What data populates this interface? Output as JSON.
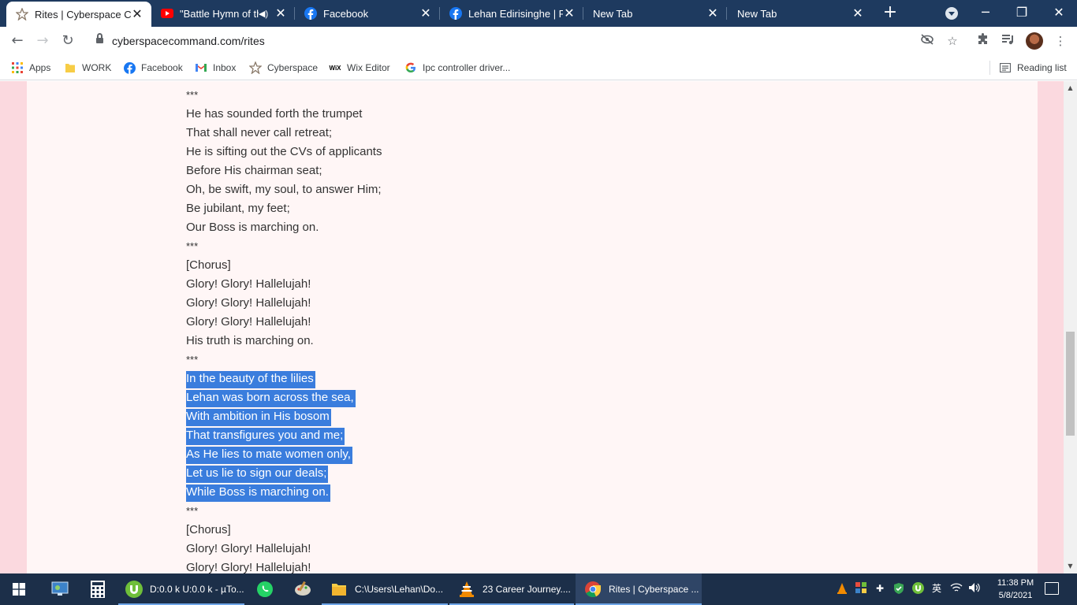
{
  "browser": {
    "tabs": [
      {
        "title": "Rites | Cyberspace Co",
        "icon": "cyberspace-star-icon",
        "active": true
      },
      {
        "title": "\"Battle Hymn of th",
        "icon": "youtube-icon",
        "audio": true
      },
      {
        "title": "Facebook",
        "icon": "facebook-icon"
      },
      {
        "title": "Lehan Edirisinghe | Fa",
        "icon": "facebook-icon"
      },
      {
        "title": "New Tab",
        "icon": ""
      },
      {
        "title": "New Tab",
        "icon": ""
      }
    ],
    "url": "cyberspacecommand.com/rites",
    "bookmarks": [
      {
        "label": "Apps",
        "icon": "apps-grid-icon"
      },
      {
        "label": "WORK",
        "icon": "folder-icon"
      },
      {
        "label": "Facebook",
        "icon": "facebook-icon"
      },
      {
        "label": "Inbox",
        "icon": "gmail-icon"
      },
      {
        "label": "Cyberspace",
        "icon": "cyberspace-star-icon"
      },
      {
        "label": "Wix Editor",
        "icon": "wix-icon"
      },
      {
        "label": "Ipc controller driver...",
        "icon": "google-icon"
      }
    ],
    "reading_list": "Reading list",
    "wix_logo_text": "WiX"
  },
  "page": {
    "lines": [
      {
        "text": "***",
        "type": "stars"
      },
      {
        "text": "He has sounded forth the trumpet",
        "type": "text"
      },
      {
        "text": "That shall never call retreat;",
        "type": "text"
      },
      {
        "text": "He is sifting out the CVs of applicants",
        "type": "text"
      },
      {
        "text": "Before His chairman seat;",
        "type": "text"
      },
      {
        "text": "Oh, be swift, my soul, to answer Him;",
        "type": "text"
      },
      {
        "text": "Be jubilant, my feet;",
        "type": "text"
      },
      {
        "text": "Our Boss is marching on.",
        "type": "text"
      },
      {
        "text": "***",
        "type": "stars"
      },
      {
        "text": "[Chorus]",
        "type": "text"
      },
      {
        "text": "Glory! Glory! Hallelujah!",
        "type": "text"
      },
      {
        "text": "Glory! Glory! Hallelujah!",
        "type": "text"
      },
      {
        "text": "Glory! Glory! Hallelujah!",
        "type": "text"
      },
      {
        "text": "His truth is marching on.",
        "type": "text"
      },
      {
        "text": "***",
        "type": "stars"
      },
      {
        "text": "In the beauty of the lilies",
        "type": "selected"
      },
      {
        "text": "Lehan was born across the sea,",
        "type": "selected"
      },
      {
        "text": "With ambition in His bosom",
        "type": "selected"
      },
      {
        "text": "That transfigures you and me;",
        "type": "selected"
      },
      {
        "text": "As He lies to mate women only,",
        "type": "selected"
      },
      {
        "text": "Let us lie to sign our deals;",
        "type": "selected"
      },
      {
        "text": "While Boss is marching on.",
        "type": "selected"
      },
      {
        "text": "***",
        "type": "stars"
      },
      {
        "text": "[Chorus]",
        "type": "text"
      },
      {
        "text": "Glory! Glory! Hallelujah!",
        "type": "text"
      },
      {
        "text": "Glory! Glory! Hallelujah!",
        "type": "text"
      }
    ]
  },
  "taskbar": {
    "apps": [
      {
        "label": "D:0.0 k U:0.0 k - µTo...",
        "icon": "utorrent-icon"
      },
      {
        "label": "C:\\Users\\Lehan\\Do...",
        "icon": "file-explorer-icon"
      },
      {
        "label": "23 Career Journey....",
        "icon": "vlc-icon"
      },
      {
        "label": "Rites | Cyberspace ...",
        "icon": "chrome-icon",
        "active": true
      }
    ],
    "tray_language": "英",
    "time": "11:38 PM",
    "date": "5/8/2021"
  },
  "colors": {
    "titlebar": "#1e3a5f",
    "page_bg": "#fff6f6",
    "page_margin": "#fbd9df",
    "selection": "#3a7ddd",
    "taskbar": "#1c2f49"
  }
}
